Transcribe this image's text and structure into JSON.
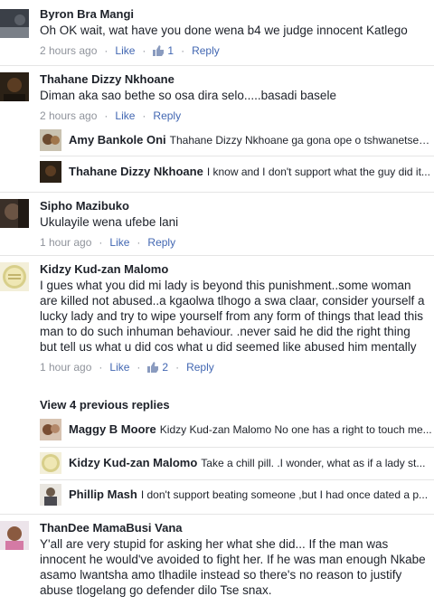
{
  "comments": [
    {
      "name": "Byron Bra Mangi",
      "text": "Oh OK wait, wat have you done wena b4 we judge innocent Katlego",
      "time": "2 hours ago",
      "like": "Like",
      "reply": "Reply",
      "likes": "1"
    },
    {
      "name": "Thahane Dizzy Nkhoane",
      "text": "Diman aka sao bethe so osa dira selo.....basadi basele",
      "time": "2 hours ago",
      "like": "Like",
      "reply": "Reply"
    },
    {
      "name": "Sipho Mazibuko",
      "text": "Ukulayile wena ufebe lani",
      "time": "1 hour ago",
      "like": "Like",
      "reply": "Reply"
    },
    {
      "name": "Kidzy Kud-zan Malomo",
      "text": "I gues what you did mi lady is beyond this punishment..some woman are killed not abused..a kgaolwa tlhogo a swa claar, consider yourself a lucky lady and try to wipe yourself from any form of things that lead this man to do such inhuman behaviour. .never said he did the right thing but tell us what u did cos what u did seemed like abused him mentally",
      "time": "1 hour ago",
      "like": "Like",
      "reply": "Reply",
      "likes": "2"
    },
    {
      "name": "ThanDee MamaBusi Vana",
      "text": "Y'all are very stupid for asking her what she did... If the man was innocent he would've avoided to fight her. If he was man enough Nkabe asamo lwantsha amo tlhadile instead so there's no reason to justify abuse tlogelang go defender dilo Tse snax."
    }
  ],
  "replies_thahane": [
    {
      "name": "Amy Bankole Oni",
      "text": "Thahane Dizzy Nkhoane ga gona ope o tshwanetsen..."
    },
    {
      "name": "Thahane Dizzy Nkhoane",
      "text": "I know and I don't support what the guy did it..."
    }
  ],
  "view_previous": "View 4 previous replies",
  "replies_kidzy": [
    {
      "name": "Maggy B Moore",
      "text": "Kidzy Kud-zan Malomo No one has a right to touch me..."
    },
    {
      "name": "Kidzy Kud-zan Malomo",
      "text": "Take a chill pill. .I wonder, what as if a lady st..."
    },
    {
      "name": "Phillip Mash",
      "text": "I don't support beating someone ,but I had once dated a p..."
    }
  ],
  "colors": {
    "link": "#4267b2",
    "meta": "#90949c",
    "text": "#1d2129"
  }
}
